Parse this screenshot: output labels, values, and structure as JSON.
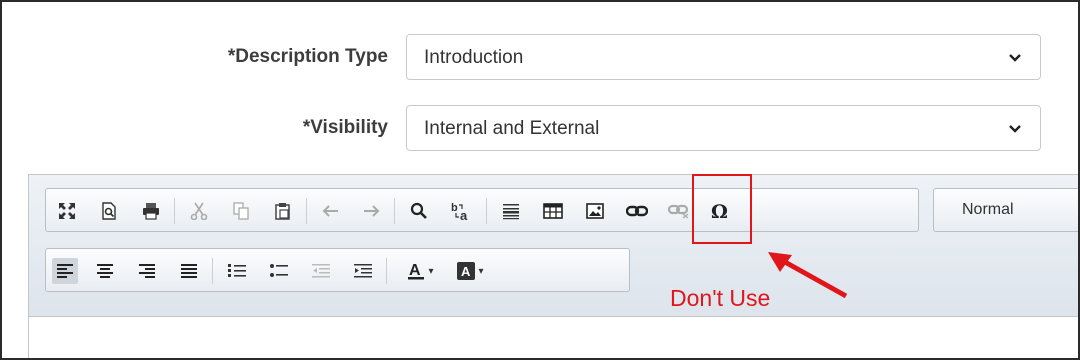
{
  "form": {
    "description_type": {
      "label": "*Description Type",
      "value": "Introduction"
    },
    "visibility": {
      "label": "*Visibility",
      "value": "Internal and External"
    }
  },
  "toolbar": {
    "row1": [
      "maximize-icon",
      "preview-icon",
      "print-icon",
      "cut-icon",
      "copy-icon",
      "paste-icon",
      "undo-icon",
      "redo-icon",
      "find-icon",
      "replace-icon",
      "horizontal-rule-icon",
      "table-icon",
      "image-icon",
      "link-icon",
      "unlink-icon",
      "special-char-icon"
    ],
    "format_select": "Normal",
    "row2": [
      "align-left-icon",
      "align-center-icon",
      "align-right-icon",
      "justify-icon",
      "numbered-list-icon",
      "bulleted-list-icon",
      "outdent-icon",
      "indent-icon",
      "text-color-icon",
      "background-color-icon"
    ]
  },
  "annotation": {
    "text": "Don't Use",
    "color": "#e0161a"
  }
}
